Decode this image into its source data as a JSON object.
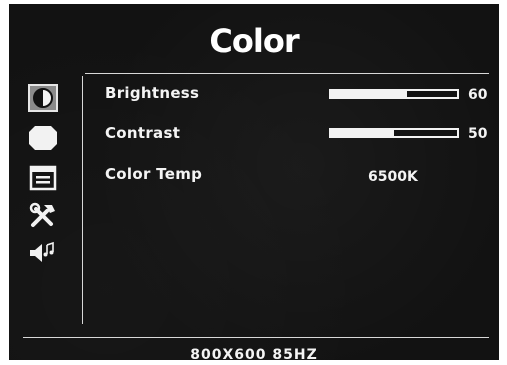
{
  "menu": {
    "title": "Color",
    "side_icons": [
      {
        "name": "color-icon",
        "selected": true
      },
      {
        "name": "image-icon",
        "selected": false
      },
      {
        "name": "osd-settings-icon",
        "selected": false
      },
      {
        "name": "tools-icon",
        "selected": false
      },
      {
        "name": "audio-icon",
        "selected": false
      }
    ]
  },
  "settings": {
    "brightness": {
      "label": "Brightness",
      "value": "60",
      "level": 0.6
    },
    "contrast": {
      "label": "Contrast",
      "value": "50",
      "level": 0.5
    },
    "color_temp": {
      "label": "Color Temp",
      "value": "6500K"
    }
  },
  "status": {
    "resolution": "800X600  85HZ"
  },
  "colors": {
    "background": "#121212",
    "foreground": "#f2f2f2"
  }
}
